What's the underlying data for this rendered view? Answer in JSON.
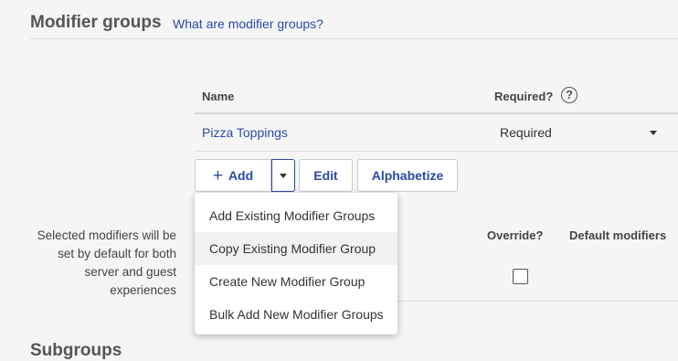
{
  "section": {
    "title": "Modifier groups",
    "help_link": "What are modifier groups?"
  },
  "table": {
    "columns": {
      "name": "Name",
      "required": "Required?",
      "help_icon": "?"
    },
    "rows": [
      {
        "name": "Pizza Toppings",
        "required": "Required"
      }
    ]
  },
  "toolbar": {
    "add_icon": "+",
    "add_label": "Add",
    "edit_label": "Edit",
    "alphabetize_label": "Alphabetize"
  },
  "add_menu": {
    "items": [
      "Add Existing Modifier Groups",
      "Copy Existing Modifier Group",
      "Create New Modifier Group",
      "Bulk Add New Modifier Groups"
    ]
  },
  "defaults": {
    "note": "Selected modifiers will be set by default for both server and guest experiences",
    "override_label": "Override?",
    "default_label": "Default modifiers",
    "override_checked": false
  },
  "next_section": {
    "title": "Subgroups"
  },
  "colors": {
    "link": "#2b4aa8",
    "background": "#f5f5f5"
  }
}
